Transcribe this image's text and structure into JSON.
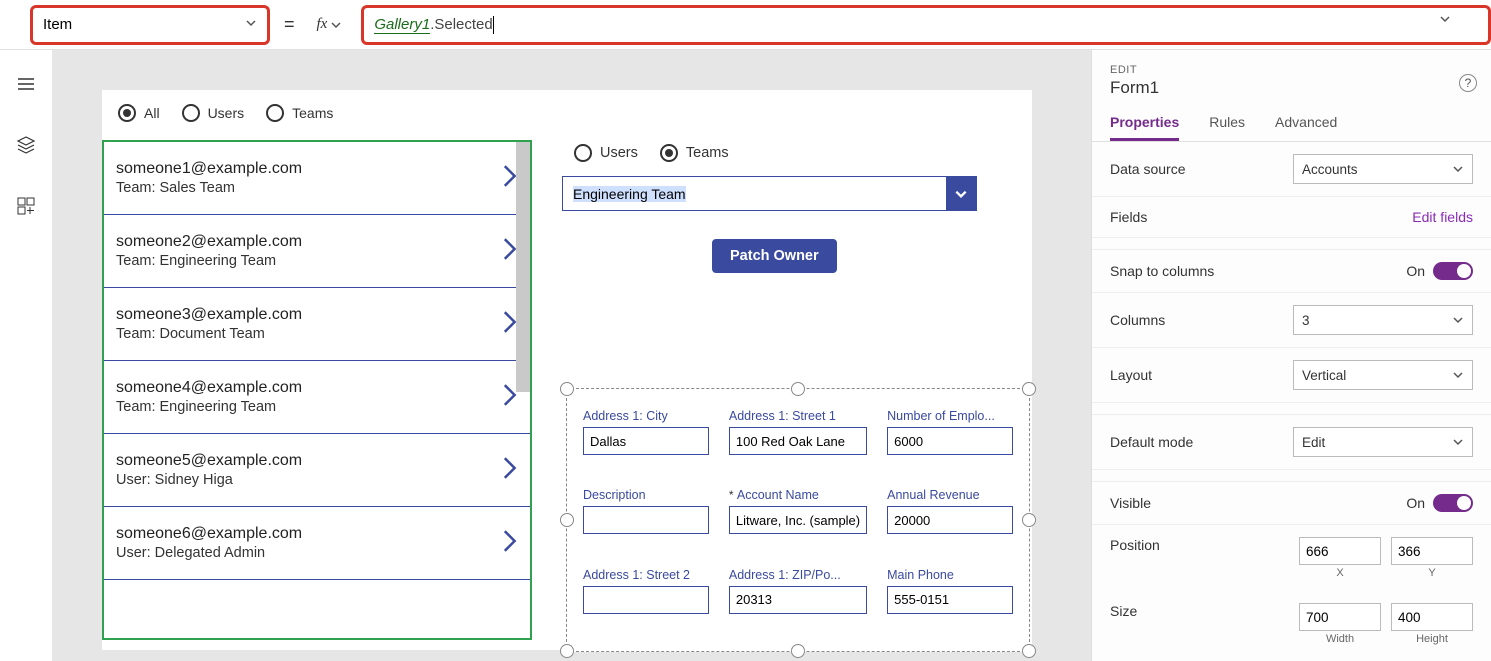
{
  "formula_bar": {
    "property": "Item",
    "fx": "fx",
    "ref": "Gallery1",
    "selected": ".Selected"
  },
  "gallery_filter": {
    "opts": [
      "All",
      "Users",
      "Teams"
    ],
    "selected": "All"
  },
  "gallery_items": [
    {
      "email": "someone1@example.com",
      "sub": "Team: Sales Team"
    },
    {
      "email": "someone2@example.com",
      "sub": "Team: Engineering Team"
    },
    {
      "email": "someone3@example.com",
      "sub": "Team: Document Team"
    },
    {
      "email": "someone4@example.com",
      "sub": "Team: Engineering Team"
    },
    {
      "email": "someone5@example.com",
      "sub": "User: Sidney Higa"
    },
    {
      "email": "someone6@example.com",
      "sub": "User: Delegated Admin"
    }
  ],
  "owner_picker": {
    "opts": [
      "Users",
      "Teams"
    ],
    "selected": "Teams",
    "dropdown_value": "Engineering Team",
    "button": "Patch Owner"
  },
  "form_fields": [
    {
      "label": "Address 1: City",
      "value": "Dallas"
    },
    {
      "label": "Address 1: Street 1",
      "value": "100 Red Oak Lane"
    },
    {
      "label": "Number of Emplo...",
      "value": "6000"
    },
    {
      "label": "Description",
      "value": ""
    },
    {
      "label": "Account Name",
      "value": "Litware, Inc. (sample)",
      "required": true
    },
    {
      "label": "Annual Revenue",
      "value": "20000"
    },
    {
      "label": "Address 1: Street 2",
      "value": ""
    },
    {
      "label": "Address 1: ZIP/Po...",
      "value": "20313"
    },
    {
      "label": "Main Phone",
      "value": "555-0151"
    }
  ],
  "props": {
    "edit": "EDIT",
    "name": "Form1",
    "tabs": [
      "Properties",
      "Rules",
      "Advanced"
    ],
    "data_source_label": "Data source",
    "data_source_value": "Accounts",
    "fields_label": "Fields",
    "edit_fields": "Edit fields",
    "snap_label": "Snap to columns",
    "snap_value": "On",
    "columns_label": "Columns",
    "columns_value": "3",
    "layout_label": "Layout",
    "layout_value": "Vertical",
    "default_mode_label": "Default mode",
    "default_mode_value": "Edit",
    "visible_label": "Visible",
    "visible_value": "On",
    "position_label": "Position",
    "position_x": "666",
    "position_y": "366",
    "size_label": "Size",
    "size_w": "700",
    "size_h": "400",
    "x": "X",
    "y": "Y",
    "w": "Width",
    "h": "Height"
  }
}
